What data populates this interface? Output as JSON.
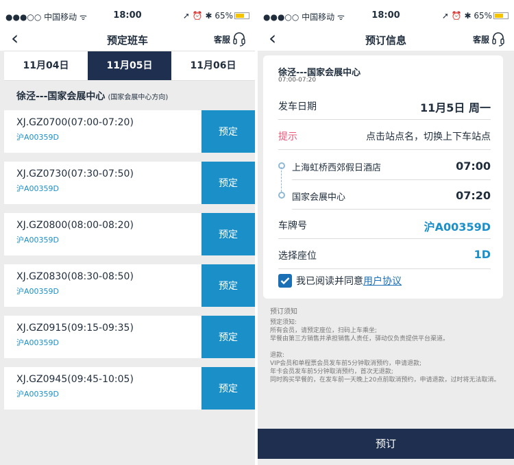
{
  "left": {
    "status": {
      "carrier": "●●●○○ 中国移动 ᯤ",
      "time": "18:00",
      "right": "➚ ⏰ ✱ 65%"
    },
    "nav": {
      "title": "预定班车",
      "service": "客服"
    },
    "dates": [
      "11月04日",
      "11月05日",
      "11月06日"
    ],
    "route": {
      "name": "徐泾---国家会展中心",
      "direction": "(国家会展中心方向)"
    },
    "trips": [
      {
        "code": "XJ.GZ0700(07:00-07:20)",
        "plate": "沪A00359D",
        "book": "预定"
      },
      {
        "code": "XJ.GZ0730(07:30-07:50)",
        "plate": "沪A00359D",
        "book": "预定"
      },
      {
        "code": "XJ.GZ0800(08:00-08:20)",
        "plate": "沪A00359D",
        "book": "预定"
      },
      {
        "code": "XJ.GZ0830(08:30-08:50)",
        "plate": "沪A00359D",
        "book": "预定"
      },
      {
        "code": "XJ.GZ0915(09:15-09:35)",
        "plate": "沪A00359D",
        "book": "预定"
      },
      {
        "code": "XJ.GZ0945(09:45-10:05)",
        "plate": "沪A00359D",
        "book": "预定"
      }
    ]
  },
  "right": {
    "status": {
      "carrier": "●●●○○ 中国移动 ᯤ",
      "time": "18:00",
      "right": "➚ ⏰ ✱ 65%"
    },
    "nav": {
      "title": "预订信息",
      "service": "客服"
    },
    "route": {
      "name": "徐泾---国家会展中心",
      "time": "07:00-07:20"
    },
    "date_label": "发车日期",
    "date_value": "11月5日 周一",
    "hint_label": "提示",
    "hint_value": "点击站点名，切换上下车站点",
    "stops": [
      {
        "name": "上海虹桥西郊假日酒店",
        "time": "07:00"
      },
      {
        "name": "国家会展中心",
        "time": "07:20"
      }
    ],
    "plate_label": "车牌号",
    "plate_value": "沪A00359D",
    "seat_label": "选择座位",
    "seat_value": "1D",
    "agree_text": "我已阅读并同意",
    "agree_link": "用户协议",
    "notice_title": "预订须知",
    "notice_lines_1": [
      "预定须知:",
      "所有会员，请预定座位，扫码上车乘坐;",
      "早餐由第三方销售并承担销售人责任，驿动仅负责提供平台渠道。"
    ],
    "notice_lines_2": [
      "退款:",
      "VIP会员和单程票会员发车前5分钟取消预约，申请退款;",
      "年卡会员发车前5分钟取消预约，首次无退款;",
      "同时购买早餐的，在发车前一天晚上20点前取消预约，申请退款，过时将无法取消。"
    ],
    "submit": "预订"
  },
  "colors": {
    "accent_blue": "#1a8fc8",
    "navy": "#1e2f4f",
    "hint_pink": "#e8577a"
  }
}
